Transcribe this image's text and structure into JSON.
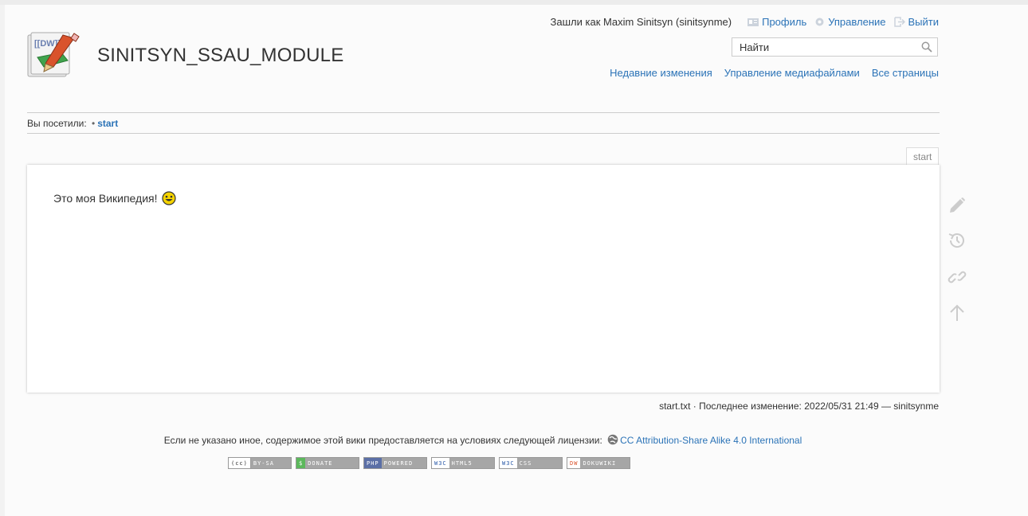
{
  "header": {
    "site_title": "SINITSYN_SSAU_MODULE",
    "logo_text": "[[DW]]",
    "usertools": {
      "logged_in_as": "Зашли как Maxim Sinitsyn (sinitsynme)",
      "profile": "Профиль",
      "admin": "Управление",
      "logout": "Выйти"
    },
    "search": {
      "placeholder": "Найти"
    },
    "sitetools": {
      "recent": "Недавние изменения",
      "media": "Управление медиафайлами",
      "index": "Все страницы"
    }
  },
  "breadcrumb": {
    "label": "Вы посетили:",
    "sep": "•",
    "item": "start"
  },
  "page": {
    "id": "start",
    "text": "Это моя Википедия!"
  },
  "pagetools": [
    "edit-icon",
    "history-icon",
    "backlinks-icon",
    "back-to-top-icon"
  ],
  "docinfo": "start.txt · Последнее изменение: 2022/05/31 21:49 — sinitsynme",
  "footer": {
    "license_text": "Если не указано иное, содержимое этой вики предоставляется на условиях следующей лицензии:",
    "license_link": "CC Attribution-Share Alike 4.0 International",
    "badges": [
      {
        "left": "(cc)",
        "right": "BY-SA",
        "color": "#a0a0a0"
      },
      {
        "left": "$",
        "right": "DONATE",
        "color": "#5cb85c"
      },
      {
        "left": "PHP",
        "right": "POWERED",
        "color": "#5b6fa6"
      },
      {
        "left": "W3C",
        "right": "HTML5",
        "color": "#ffffff"
      },
      {
        "left": "W3C",
        "right": "CSS",
        "color": "#ffffff"
      },
      {
        "left": "DW",
        "right": "DOKUWIKI",
        "color": "#ffffff"
      }
    ]
  },
  "colors": {
    "link": "#2b73b7",
    "text": "#333333",
    "border": "#cccccc"
  }
}
